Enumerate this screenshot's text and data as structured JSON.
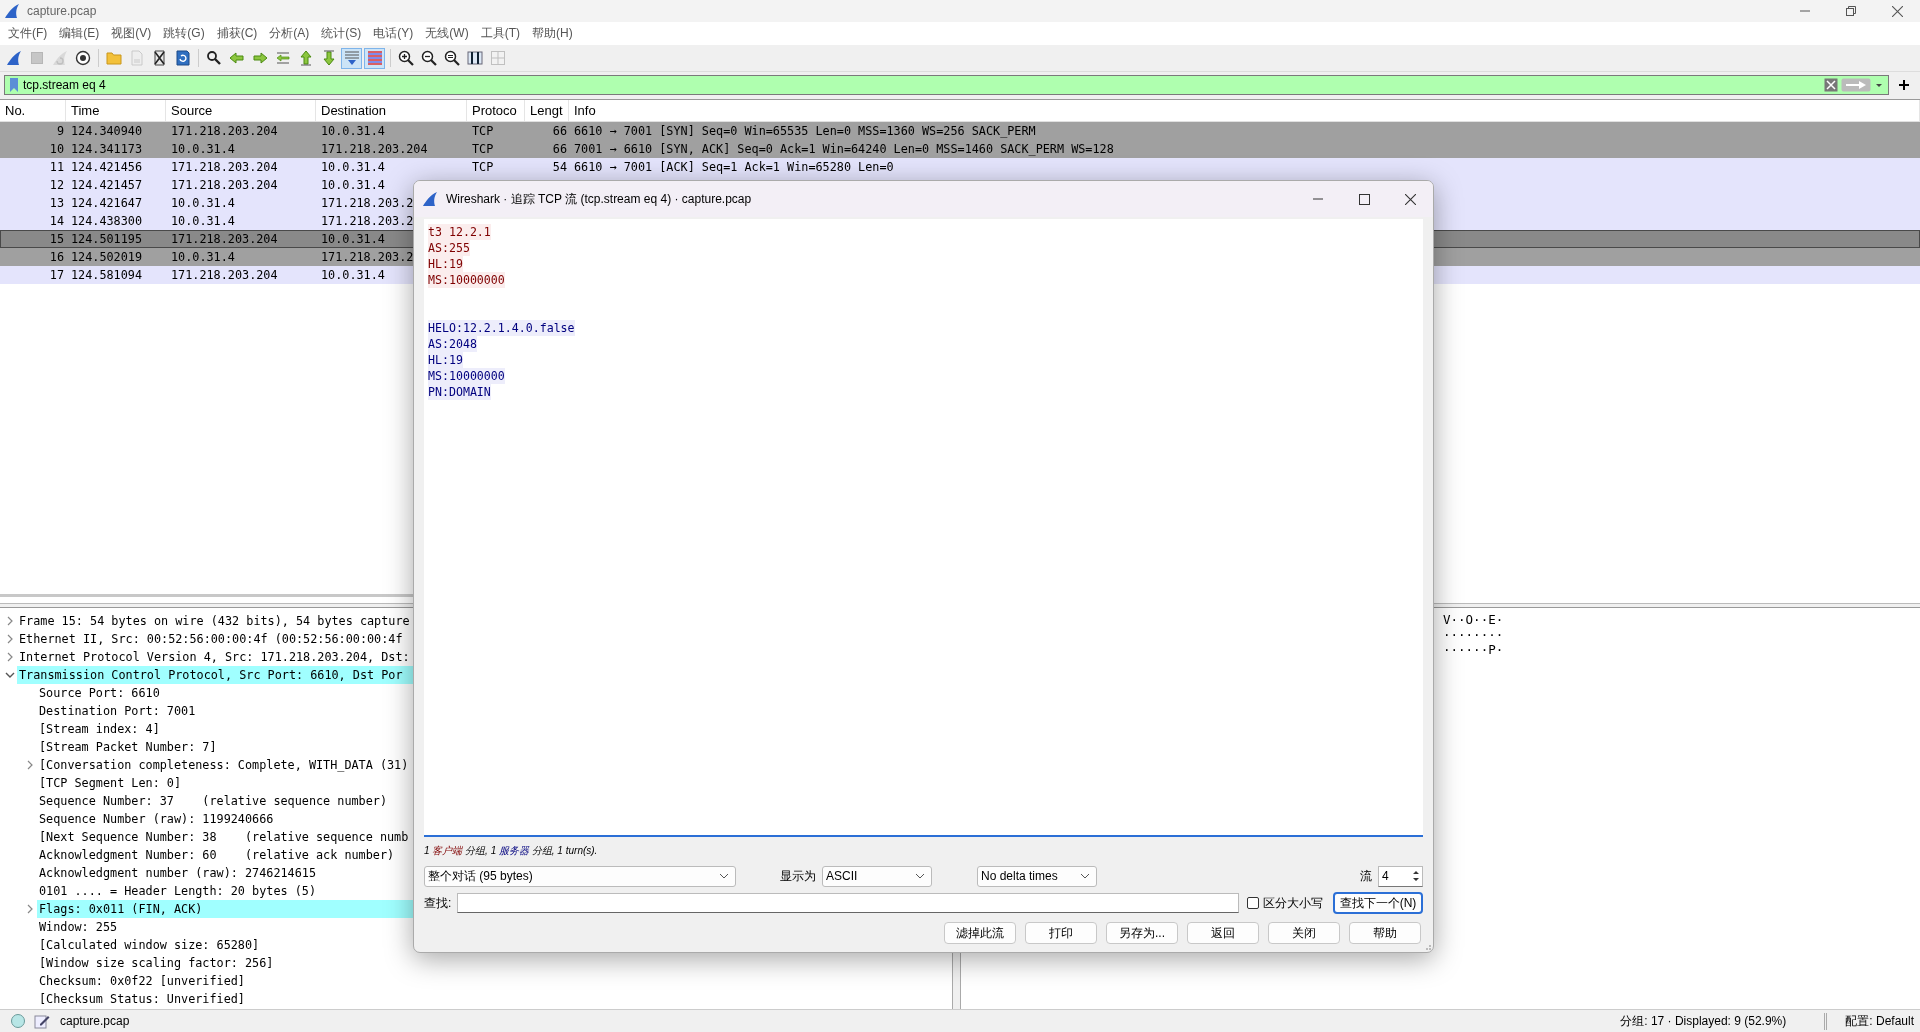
{
  "window": {
    "title": "capture.pcap"
  },
  "menu": [
    "文件(F)",
    "编辑(E)",
    "视图(V)",
    "跳转(G)",
    "捕获(C)",
    "分析(A)",
    "统计(S)",
    "电话(Y)",
    "无线(W)",
    "工具(T)",
    "帮助(H)"
  ],
  "toolbar": [
    [
      {
        "kind": "start",
        "on": false,
        "disabled": false
      },
      {
        "kind": "stop",
        "on": false,
        "disabled": true
      },
      {
        "kind": "restart",
        "on": false,
        "disabled": true
      },
      {
        "kind": "options",
        "on": false,
        "disabled": false
      }
    ],
    [
      {
        "kind": "open",
        "on": false,
        "disabled": false
      },
      {
        "kind": "save",
        "on": false,
        "disabled": true
      },
      {
        "kind": "close",
        "on": false,
        "disabled": false
      },
      {
        "kind": "reload",
        "on": false,
        "disabled": false
      }
    ],
    [
      {
        "kind": "find",
        "on": false,
        "disabled": false
      },
      {
        "kind": "back",
        "on": false,
        "disabled": false
      },
      {
        "kind": "forward",
        "on": false,
        "disabled": false
      },
      {
        "kind": "goto",
        "on": false,
        "disabled": false
      },
      {
        "kind": "first",
        "on": false,
        "disabled": false
      },
      {
        "kind": "last",
        "on": false,
        "disabled": false
      },
      {
        "kind": "autoscroll",
        "on": true,
        "disabled": false
      },
      {
        "kind": "colorize",
        "on": true,
        "disabled": false
      }
    ],
    [
      {
        "kind": "zoomin",
        "on": false,
        "disabled": false
      },
      {
        "kind": "zoomout",
        "on": false,
        "disabled": false
      },
      {
        "kind": "zoomreset",
        "on": false,
        "disabled": false
      },
      {
        "kind": "resize",
        "on": false,
        "disabled": false
      },
      {
        "kind": "layout",
        "on": false,
        "disabled": true
      }
    ]
  ],
  "filter": {
    "value": "tcp.stream eq 4",
    "valid": true
  },
  "packets": {
    "columns": [
      "No.",
      "Time",
      "Source",
      "Destination",
      "Protoco",
      "Lengt",
      "Info"
    ],
    "rows": [
      {
        "cells": [
          "9",
          "124.340940",
          "171.218.203.204",
          "10.0.31.4",
          "TCP",
          "66",
          "6610 → 7001 [SYN] Seq=0 Win=65535 Len=0 MSS=1360 WS=256 SACK_PERM"
        ],
        "color": "#a0a0a0",
        "selected": false
      },
      {
        "cells": [
          "10",
          "124.341173",
          "10.0.31.4",
          "171.218.203.204",
          "TCP",
          "66",
          "7001 → 6610 [SYN, ACK] Seq=0 Ack=1 Win=64240 Len=0 MSS=1460 SACK_PERM WS=128"
        ],
        "color": "#a0a0a0",
        "selected": false
      },
      {
        "cells": [
          "11",
          "124.421456",
          "171.218.203.204",
          "10.0.31.4",
          "TCP",
          "54",
          "6610 → 7001 [ACK] Seq=1 Ack=1 Win=65280 Len=0"
        ],
        "color": "#e4e4fc",
        "selected": false
      },
      {
        "cells": [
          "12",
          "124.421457",
          "171.218.203.204",
          "10.0.31.4"
        ],
        "color": "#e4e4fc",
        "selected": false
      },
      {
        "cells": [
          "13",
          "124.421647",
          "10.0.31.4",
          "171.218.203.2"
        ],
        "color": "#e4e4fc",
        "selected": false
      },
      {
        "cells": [
          "14",
          "124.438300",
          "10.0.31.4",
          "171.218.203.2"
        ],
        "color": "#e4e4fc",
        "selected": false
      },
      {
        "cells": [
          "15",
          "124.501195",
          "171.218.203.204",
          "10.0.31.4"
        ],
        "color": "#a0a0a0",
        "selected": true
      },
      {
        "cells": [
          "16",
          "124.502019",
          "10.0.31.4",
          "171.218.203.2"
        ],
        "color": "#a0a0a0",
        "selected": false
      },
      {
        "cells": [
          "17",
          "124.581094",
          "171.218.203.204",
          "10.0.31.4"
        ],
        "color": "#e4e4fc",
        "selected": false
      }
    ]
  },
  "details": [
    {
      "text": "Frame 15: 54 bytes on wire (432 bits), 54 bytes capture",
      "expanded": false,
      "highlighted": false
    },
    {
      "text": "Ethernet II, Src: 00:52:56:00:00:4f (00:52:56:00:00:4f",
      "expanded": false,
      "highlighted": false
    },
    {
      "text": "Internet Protocol Version 4, Src: 171.218.203.204, Dst:",
      "expanded": false,
      "highlighted": false
    },
    {
      "text": "Transmission Control Protocol, Src Port: 6610, Dst Por",
      "expanded": true,
      "highlighted": true,
      "children": [
        {
          "text": "Source Port: 6610",
          "highlighted": false
        },
        {
          "text": "Destination Port: 7001",
          "highlighted": false
        },
        {
          "text": "[Stream index: 4]",
          "highlighted": false
        },
        {
          "text": "[Stream Packet Number: 7]",
          "highlighted": false
        },
        {
          "text": "[Conversation completeness: Complete, WITH_DATA (31)",
          "expanded": false,
          "highlighted": false
        },
        {
          "text": "[TCP Segment Len: 0]",
          "highlighted": false
        },
        {
          "text": "Sequence Number: 37    (relative sequence number)",
          "highlighted": false
        },
        {
          "text": "Sequence Number (raw): 1199240666",
          "highlighted": false
        },
        {
          "text": "[Next Sequence Number: 38    (relative sequence numb",
          "highlighted": false
        },
        {
          "text": "Acknowledgment Number: 60    (relative ack number)",
          "highlighted": false
        },
        {
          "text": "Acknowledgment number (raw): 2746214615",
          "highlighted": false
        },
        {
          "text": "0101 .... = Header Length: 20 bytes (5)",
          "highlighted": false
        },
        {
          "text": "Flags: 0x011 (FIN, ACK)",
          "expanded": false,
          "highlighted": true
        },
        {
          "text": "Window: 255",
          "highlighted": false
        },
        {
          "text": "[Calculated window size: 65280]",
          "highlighted": false
        },
        {
          "text": "[Window size scaling factor: 256]",
          "highlighted": false
        },
        {
          "text": "Checksum: 0x0f22 [unverified]",
          "highlighted": false
        },
        {
          "text": "[Checksum Status: Unverified]",
          "highlighted": false
        }
      ]
    }
  ],
  "bytes": {
    "ascii": [
      "V··O··E·",
      "········",
      "······P·"
    ]
  },
  "follow_dialog": {
    "title": "Wireshark · 追踪 TCP 流 (tcp.stream eq 4) · capture.pcap",
    "stream": [
      {
        "kind": "client",
        "lines": [
          "t3 12.2.1",
          "AS:255",
          "HL:19",
          "MS:10000000"
        ]
      },
      {
        "kind": "server",
        "lines": [
          "HELO:12.2.1.4.0.false",
          "AS:2048",
          "HL:19",
          "MS:10000000",
          "PN:DOMAIN"
        ]
      }
    ],
    "summary": [
      {
        "text": "1 ",
        "kind": "plain"
      },
      {
        "text": "客户端",
        "kind": "client"
      },
      {
        "text": " 分组, 1 ",
        "kind": "plain"
      },
      {
        "text": "服务器",
        "kind": "server"
      },
      {
        "text": " 分组, 1 turn(s).",
        "kind": "plain"
      }
    ],
    "conversation": "整个对话 (95 bytes)",
    "show_as_label": "显示为",
    "show_as": "ASCII",
    "delta": "No delta times",
    "stream_label": "流",
    "stream_number": "4",
    "find_label": "查找:",
    "case_sensitive": {
      "label": "区分大小写",
      "checked": false
    },
    "find_next": "查找下一个(N)",
    "buttons": [
      "滤掉此流",
      "打印",
      "另存为...",
      "返回",
      "关闭",
      "帮助"
    ]
  },
  "status": {
    "file": "capture.pcap",
    "stats": "分组: 17 · Displayed: 9 (52.9%)",
    "profile": "配置: Default"
  }
}
